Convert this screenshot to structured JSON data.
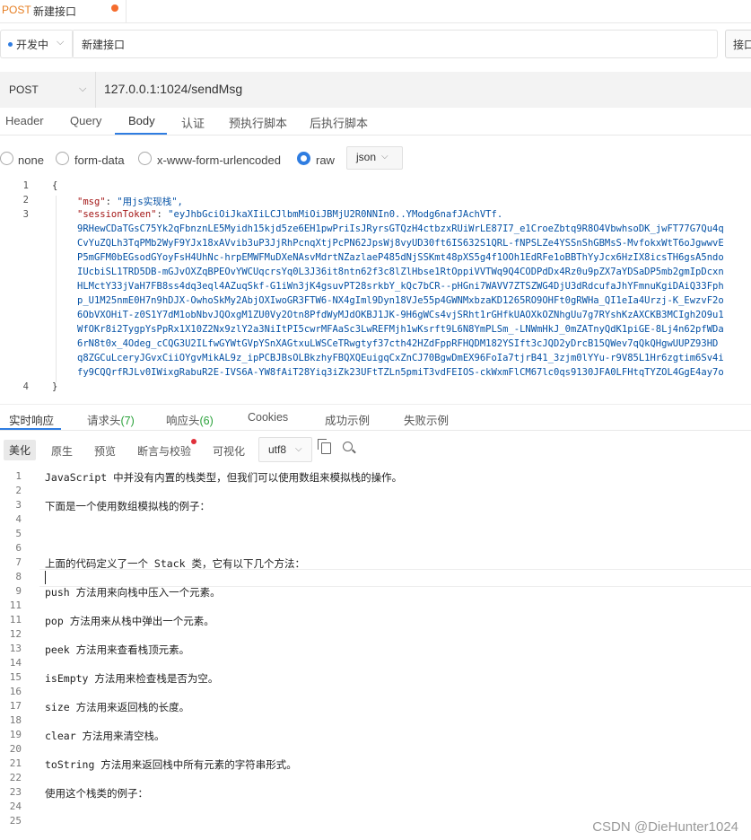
{
  "tab": {
    "method": "POST",
    "name": "新建接口"
  },
  "env": {
    "label": "开发中"
  },
  "request_name": "新建接口",
  "save_label": "接口",
  "url_bar": {
    "method": "POST",
    "url": "127.0.0.1:1024/sendMsg"
  },
  "request_tabs": [
    "Header",
    "Query",
    "Body",
    "认证",
    "预执行脚本",
    "后执行脚本"
  ],
  "body_types": [
    "none",
    "form-data",
    "x-www-form-urlencoded",
    "raw"
  ],
  "body_format": "json",
  "code_lines": [
    {
      "n": "1",
      "text": "{"
    },
    {
      "n": "2",
      "key": "\"msg\"",
      "sep": ": ",
      "val": "\"用js实现栈\","
    },
    {
      "n": "3",
      "key": "\"sessionToken\"",
      "sep": ": ",
      "val": "\"eyJhbGciOiJkaXIiLCJlbmMiOiJBMjU2R0NNIn0..YModg6nafJAchVTf."
    },
    {
      "n": "",
      "val": "9RHewCDaTGsC75Yk2qFbnznLE5Myidh15kjd5ze6EH1pwPriIsJRyrsGTQzH4ctbzxRUiWrLE87I7_e1CroeZbtq9R8O4VbwhsoDK_jwFT77G7Qu4q"
    },
    {
      "n": "",
      "val": "CvYuZQLh3TqPMb2WyF9YJx18xAVvib3uP3JjRhPcnqXtjPcPN62JpsWj8vyUD30ft6IS632S1QRL-fNPSLZe4YSSnShGBMsS-MvfokxWtT6oJgwwvE"
    },
    {
      "n": "",
      "val": "P5mGFM0bEGsodGYoyFsH4UhNc-hrpEMWFMuDXeNAsvMdrtNZazlaeP485dNjSSKmt48pXS5g4f1OOh1EdRFe1oBBThYyJcx6HzIX8icsTH6gsA5ndo"
    },
    {
      "n": "",
      "val": "IUcbiSL1TRD5DB-mGJvOXZqBPEOvYWCUqcrsYq0L3J36it8ntn62f3c8lZlHbse1RtOppiVVTWq9Q4CODPdDx4Rz0u9pZX7aYDSaDP5mb2gmIpDcxn"
    },
    {
      "n": "",
      "val": "HLMctY33jVaH7FB8ss4dq3eql4AZuqSkf-G1iWn3jK4gsuvPT28srkbY_kQc7bCR--pHGni7WAVV7ZTSZWG4DjU3dRdcufaJhYFmnuKgiDAiQ33Fph"
    },
    {
      "n": "",
      "val": "p_U1M25nmE0H7n9hDJX-OwhoSkMy2AbjOXIwoGR3FTW6-NX4gIml9Dyn18VJe55p4GWNMxbzaKD1265RO9OHFt0gRWHa_QI1eIa4Urzj-K_EwzvF2o"
    },
    {
      "n": "",
      "val": "6ObVXOHiT-z0S1Y7dM1obNbvJQOxgM1ZU0Vy2Otn8PfdWyMJdOKBJ1JK-9H6gWCs4vjSRht1rGHfkUAOXkOZNhgUu7g7RYshKzAXCKB3MCIgh2O9u1"
    },
    {
      "n": "",
      "val": "WfOKr8i2TygpYsPpRx1X10Z2Nx9zlY2a3NiItPI5cwrMFAaSc3LwREFMjh1wKsrft9L6N8YmPLSm_-LNWmHkJ_0mZATnyQdK1piGE-8Lj4n62pfWDa"
    },
    {
      "n": "",
      "val": "6rN8t0x_4Odeg_cCQG3U2ILfwGYWtGVpYSnXAGtxuLWSCeTRwgtyf37cth42HZdFppRFHQDM182YSIft3cJQD2yDrcB15QWev7qQkQHgwUUPZ93HD"
    },
    {
      "n": "",
      "val": "q8ZGCuLceryJGvxCiiOYgvMikAL9z_ipPCBJBsOLBkzhyFBQXQEuigqCxZnCJ70BgwDmEX96FoIa7tjrB41_3zjm0lYYu-r9V85L1Hr6zgtim6Sv4i"
    },
    {
      "n": "",
      "val": "fy9CQQrfRJLv0IWixgRabuR2E-IVS6A-YW8fAiT28Yiq3iZk23UFtTZLn5pmiT3vdFEIOS-ckWxmFlCM67lc0qs9130JFA0LFHtqTYZOL4GgE4ay7o"
    },
    {
      "n": "4",
      "text": "}"
    }
  ],
  "response_tabs": [
    {
      "label": "实时响应",
      "count": ""
    },
    {
      "label": "请求头",
      "count": "(7)"
    },
    {
      "label": "响应头",
      "count": "(6)"
    },
    {
      "label": "Cookies",
      "count": ""
    },
    {
      "label": "成功示例",
      "count": ""
    },
    {
      "label": "失败示例",
      "count": ""
    }
  ],
  "view_modes": [
    "美化",
    "原生",
    "预览",
    "断言与校验",
    "可视化"
  ],
  "encoding": "utf8",
  "response_lines": [
    {
      "n": "1",
      "text": "JavaScript 中并没有内置的栈类型，但我们可以使用数组来模拟栈的操作。"
    },
    {
      "n": "2",
      "text": ""
    },
    {
      "n": "3",
      "text": "下面是一个使用数组模拟栈的例子："
    },
    {
      "n": "4",
      "text": ""
    },
    {
      "n": "5",
      "text": ""
    },
    {
      "n": "6",
      "text": ""
    },
    {
      "n": "7",
      "text": "上面的代码定义了一个 Stack 类，它有以下几个方法："
    },
    {
      "n": "8",
      "text": ""
    },
    {
      "n": "9",
      "text": "push 方法用来向栈中压入一个元素。"
    },
    {
      "n": "11",
      "text": ""
    },
    {
      "n": "11",
      "text": "pop 方法用来从栈中弹出一个元素。"
    },
    {
      "n": "12",
      "text": ""
    },
    {
      "n": "13",
      "text": "peek 方法用来查看栈顶元素。"
    },
    {
      "n": "14",
      "text": ""
    },
    {
      "n": "15",
      "text": "isEmpty 方法用来检查栈是否为空。"
    },
    {
      "n": "16",
      "text": ""
    },
    {
      "n": "17",
      "text": "size 方法用来返回栈的长度。"
    },
    {
      "n": "18",
      "text": ""
    },
    {
      "n": "19",
      "text": "clear 方法用来清空栈。"
    },
    {
      "n": "20",
      "text": ""
    },
    {
      "n": "21",
      "text": "toString 方法用来返回栈中所有元素的字符串形式。"
    },
    {
      "n": "22",
      "text": ""
    },
    {
      "n": "23",
      "text": "使用这个栈类的例子："
    },
    {
      "n": "24",
      "text": ""
    },
    {
      "n": "25",
      "text": ""
    }
  ],
  "watermark": "CSDN @DieHunter1024"
}
